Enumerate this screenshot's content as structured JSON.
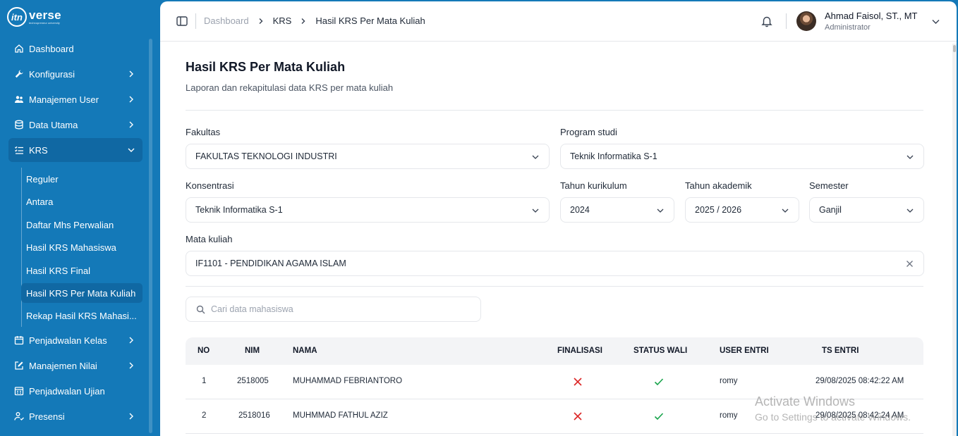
{
  "brand": {
    "mark": "itn",
    "name": "verse",
    "tagline": "technopreneur university"
  },
  "sidebar": {
    "items": [
      {
        "label": "Dashboard",
        "icon": "home-icon"
      },
      {
        "label": "Konfigurasi",
        "icon": "wrench-icon"
      },
      {
        "label": "Manajemen User",
        "icon": "users-icon"
      },
      {
        "label": "Data Utama",
        "icon": "database-icon"
      },
      {
        "label": "KRS",
        "icon": "list-icon"
      },
      {
        "label": "Penjadwalan Kelas",
        "icon": "calendar-icon"
      },
      {
        "label": "Manajemen Nilai",
        "icon": "edit-icon"
      },
      {
        "label": "Penjadwalan Ujian",
        "icon": "calendar-grid-icon"
      },
      {
        "label": "Presensi",
        "icon": "user-check-icon"
      }
    ],
    "krs_sub": [
      "Reguler",
      "Antara",
      "Daftar Mhs Perwalian",
      "Hasil KRS Mahasiswa",
      "Hasil KRS Final",
      "Hasil KRS Per Mata Kuliah",
      "Rekap Hasil KRS Mahasi..."
    ]
  },
  "breadcrumb": [
    "Dashboard",
    "KRS",
    "Hasil KRS Per Mata Kuliah"
  ],
  "user": {
    "name": "Ahmad Faisol, ST., MT",
    "role": "Administrator"
  },
  "page": {
    "title": "Hasil KRS Per Mata Kuliah",
    "subtitle": "Laporan dan rekapitulasi data KRS per mata kuliah"
  },
  "filters": {
    "fakultas": {
      "label": "Fakultas",
      "value": "FAKULTAS TEKNOLOGI INDUSTRI"
    },
    "prodi": {
      "label": "Program studi",
      "value": "Teknik Informatika S-1"
    },
    "konsentrasi": {
      "label": "Konsentrasi",
      "value": "Teknik Informatika S-1"
    },
    "kurikulum": {
      "label": "Tahun kurikulum",
      "value": "2024"
    },
    "akademik": {
      "label": "Tahun akademik",
      "value": "2025 / 2026"
    },
    "semester": {
      "label": "Semester",
      "value": "Ganjil"
    },
    "matkul": {
      "label": "Mata kuliah",
      "value": "IF1101 - PENDIDIKAN AGAMA ISLAM"
    }
  },
  "search": {
    "placeholder": "Cari data mahasiswa"
  },
  "table": {
    "headers": [
      "NO",
      "NIM",
      "NAMA",
      "FINALISASI",
      "STATUS WALI",
      "USER ENTRI",
      "TS ENTRI"
    ],
    "rows": [
      {
        "no": "1",
        "nim": "2518005",
        "nama": "MUHAMMAD FEBRIANTORO",
        "finalisasi": "no",
        "status_wali": "yes",
        "user": "romy",
        "ts": "29/08/2025 08:42:22 AM"
      },
      {
        "no": "2",
        "nim": "2518016",
        "nama": "MUHMMAD FATHUL AZIZ",
        "finalisasi": "no",
        "status_wali": "yes",
        "user": "romy",
        "ts": "29/08/2025 08:42:24 AM"
      }
    ]
  },
  "watermark": {
    "line1": "Activate Windows",
    "line2": "Go to Settings to activate Windows."
  },
  "colors": {
    "sidebar": "#1479b8",
    "active": "#1068a3",
    "cross": "#dc2626",
    "check": "#16a34a"
  }
}
